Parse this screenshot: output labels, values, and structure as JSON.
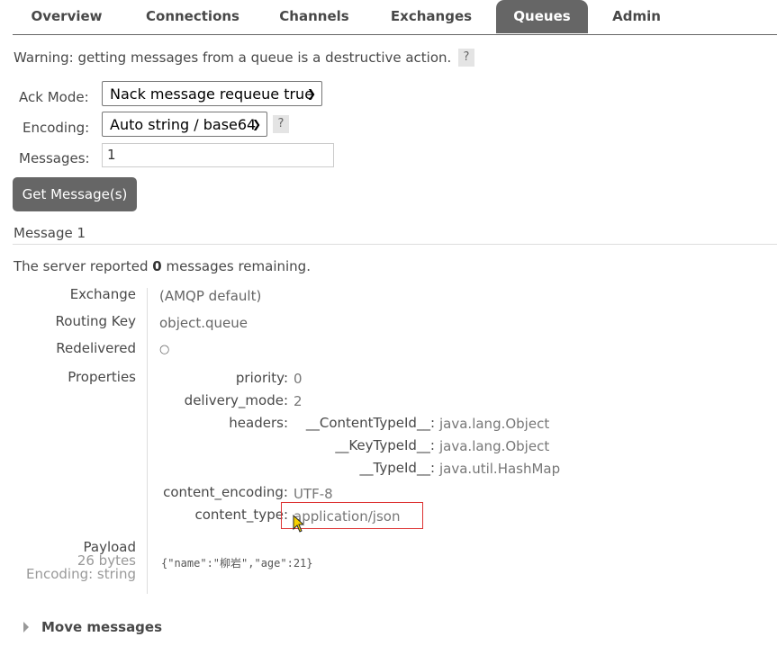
{
  "tabs": [
    "Overview",
    "Connections",
    "Channels",
    "Exchanges",
    "Queues",
    "Admin"
  ],
  "warning": {
    "text": "Warning: getting messages from a queue is a destructive action.",
    "help": "?"
  },
  "form": {
    "ack_mode_label": "Ack Mode:",
    "ack_mode_value": "Nack message requeue true",
    "encoding_label": "Encoding:",
    "encoding_value": "Auto string / base64",
    "encoding_help": "?",
    "messages_label": "Messages:",
    "messages_value": "1",
    "submit_label": "Get Message(s)"
  },
  "message": {
    "title": "Message 1",
    "remaining_prefix": "The server reported ",
    "remaining_count": "0",
    "remaining_suffix": " messages remaining.",
    "exchange_label": "Exchange",
    "exchange_value": "(AMQP default)",
    "routing_key_label": "Routing Key",
    "routing_key_value": "object.queue",
    "redelivered_label": "Redelivered",
    "redelivered_value": "○",
    "properties_label": "Properties",
    "properties": {
      "priority_key": "priority:",
      "priority_value": "0",
      "delivery_mode_key": "delivery_mode:",
      "delivery_mode_value": "2",
      "headers_key": "headers:",
      "headers": [
        {
          "key": "__ContentTypeId__:",
          "value": "java.lang.Object"
        },
        {
          "key": "__KeyTypeId__:",
          "value": "java.lang.Object"
        },
        {
          "key": "__TypeId__:",
          "value": "java.util.HashMap"
        }
      ],
      "content_encoding_key": "content_encoding:",
      "content_encoding_value": "UTF-8",
      "content_type_key": "content_type:",
      "content_type_value": "application/json"
    },
    "payload_label": "Payload",
    "payload_size": "26 bytes",
    "payload_encoding": "Encoding: string",
    "payload_value": "{\"name\":\"柳岩\",\"age\":21}"
  },
  "move_messages": "Move messages",
  "colors": {
    "tab_active_bg": "#666666",
    "button_bg": "#666666",
    "highlight_box": "#dd3333"
  }
}
